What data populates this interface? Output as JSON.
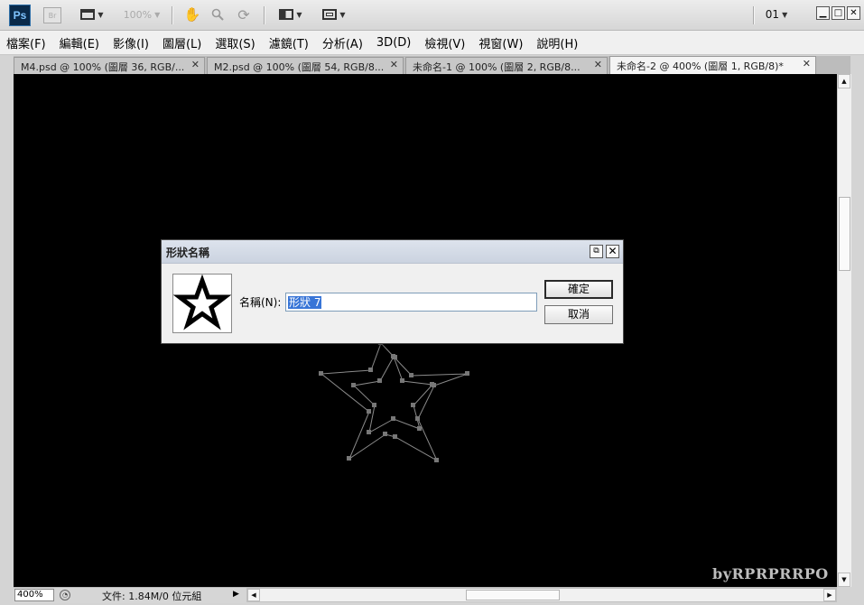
{
  "app": {
    "logo_text": "Ps",
    "bridge_text": "Br",
    "zoom_level": "100%",
    "workspace": "01",
    "win_minimize": "▁",
    "win_maximize": "□",
    "win_close": "✕"
  },
  "menu": [
    "檔案(F)",
    "編輯(E)",
    "影像(I)",
    "圖層(L)",
    "選取(S)",
    "濾鏡(T)",
    "分析(A)",
    "3D(D)",
    "檢視(V)",
    "視窗(W)",
    "說明(H)"
  ],
  "tabs": [
    {
      "label": "M4.psd @ 100% (圖層 36, RGB/..."
    },
    {
      "label": "M2.psd @ 100% (圖層 54, RGB/8..."
    },
    {
      "label": "未命名-1 @ 100% (圖層 2, RGB/8..."
    },
    {
      "label": "未命名-2 @ 400% (圖層 1, RGB/8)*"
    }
  ],
  "tab_close_glyph": "✕",
  "dialog": {
    "title": "形狀名稱",
    "name_label": "名稱(N):",
    "name_value": "形狀 7",
    "ok_label": "確定",
    "cancel_label": "取消",
    "restore_glyph": "⧉",
    "close_glyph": "✕"
  },
  "status": {
    "zoom": "400%",
    "doc_size": "文件: 1.84M/0 位元組",
    "arrow_glyph": "▶"
  },
  "watermark": "byRPRPRRPO",
  "icons": {
    "hand": "✋",
    "zoom": "🔍",
    "rotate": "⟳",
    "up": "▲",
    "down": "▼",
    "left": "◀",
    "right": "▶"
  },
  "colors": {
    "canvas": "#000000",
    "selection": "#3875d7",
    "dialog_title": "#cbd3e0",
    "path_anchor": "#7a7a7a"
  }
}
